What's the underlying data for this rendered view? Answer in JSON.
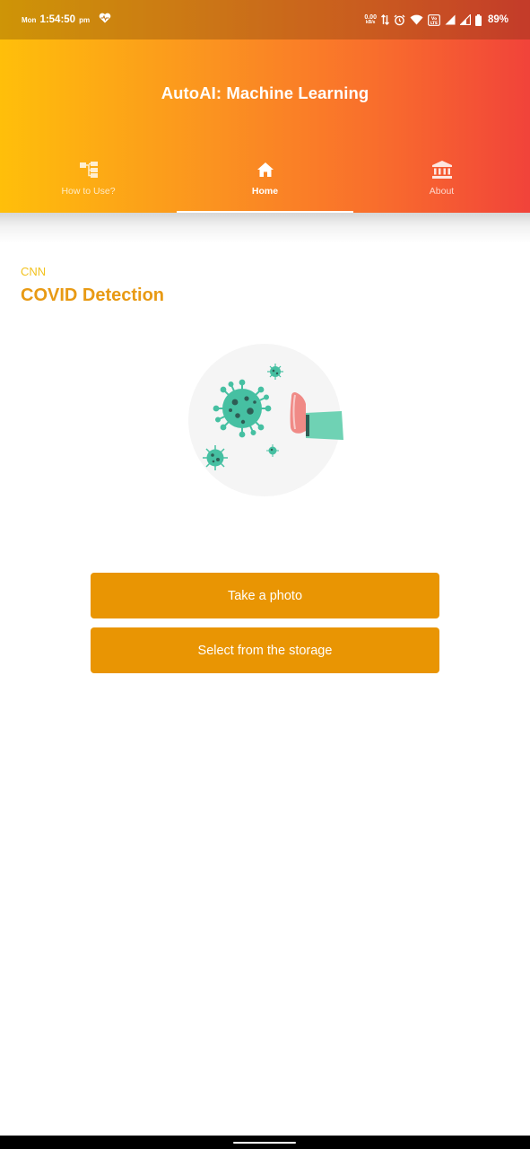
{
  "status_bar": {
    "day": "Mon",
    "time": "1:54:50",
    "ampm": "pm",
    "net_speed": "0.00",
    "net_unit": "kB/s",
    "battery": "89%",
    "icons": [
      "heart-monitor-icon",
      "data-arrows-icon",
      "alarm-icon",
      "wifi-icon",
      "volte-icon",
      "signal-icon",
      "signal-2-icon",
      "battery-icon"
    ]
  },
  "header": {
    "title": "AutoAI: Machine Learning",
    "tabs": [
      {
        "label": "How to Use?",
        "icon": "hierarchy-icon",
        "active": false
      },
      {
        "label": "Home",
        "icon": "home-icon",
        "active": true
      },
      {
        "label": "About",
        "icon": "bank-icon",
        "active": false
      }
    ]
  },
  "main": {
    "category": "CNN",
    "title": "COVID Detection",
    "illustration": "virus-stop-hand-illustration",
    "buttons": {
      "take_photo": "Take a photo",
      "select_storage": "Select from the storage"
    }
  },
  "colors": {
    "accent": "#e99503",
    "title": "#e89a14",
    "subtitle": "#f2c21e",
    "gradient_start": "#ffbf0a",
    "gradient_end": "#f1433a",
    "virus": "#46c0a2"
  }
}
